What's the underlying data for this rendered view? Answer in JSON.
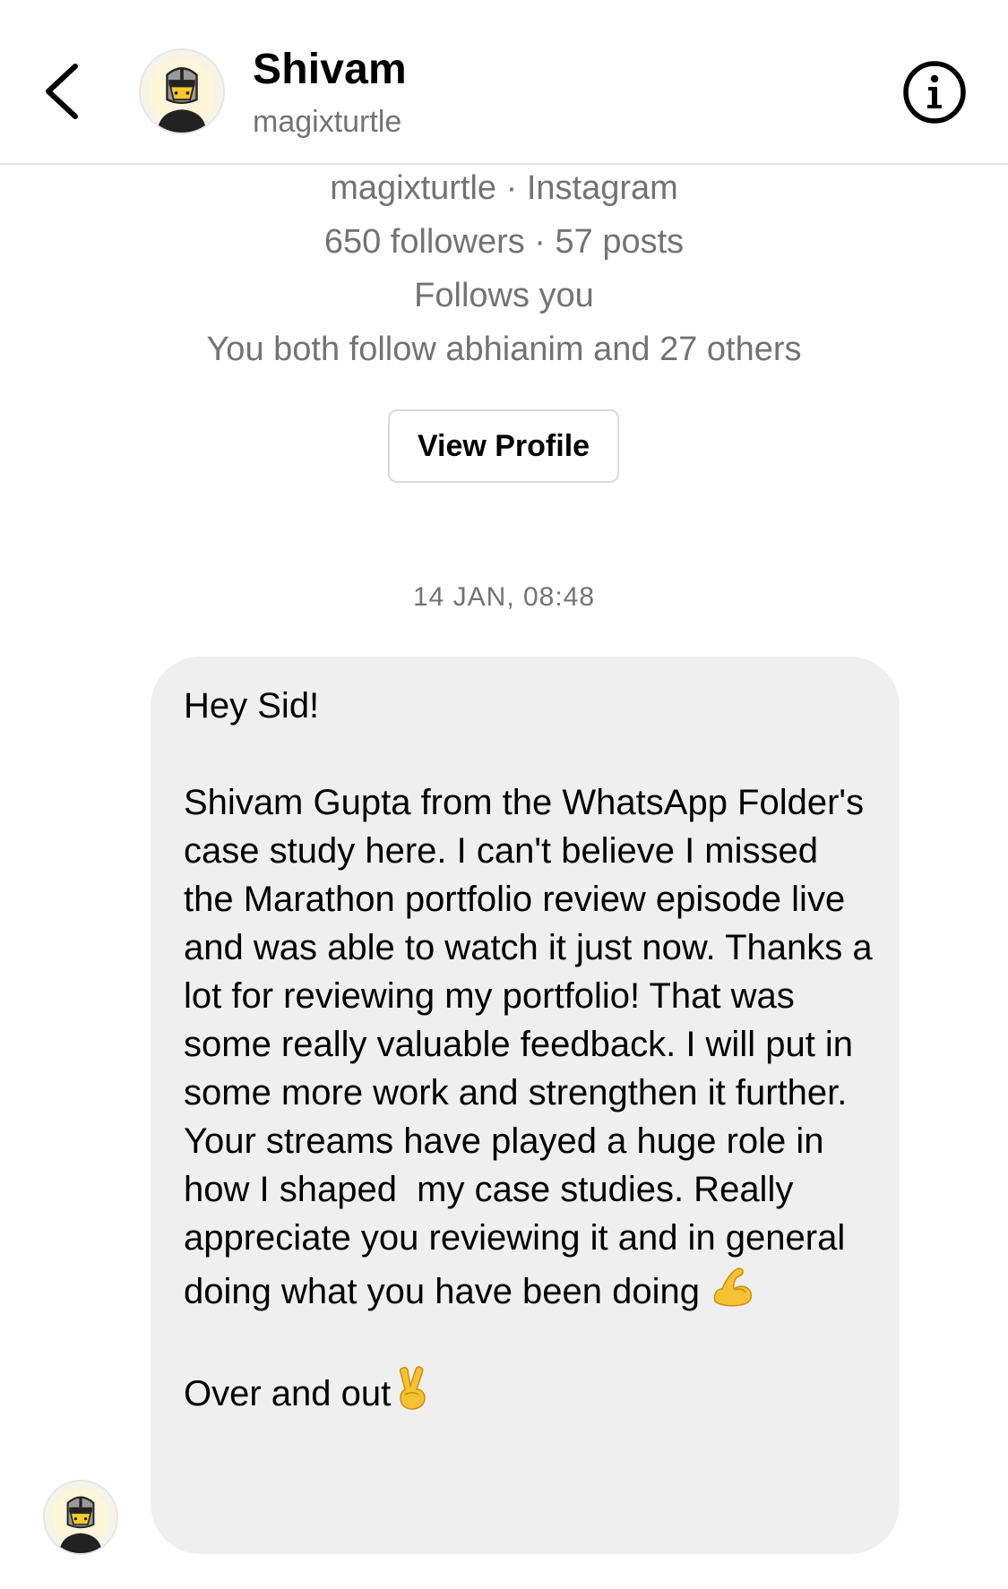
{
  "header": {
    "name": "Shivam",
    "username": "magixturtle",
    "back_icon": "chevron-left-icon",
    "info_icon": "info-circle-icon"
  },
  "profile": {
    "line1": "magixturtle · Instagram",
    "line2": "650 followers · 57 posts",
    "line3": "Follows you",
    "line4": "You both follow abhianim and 27 others",
    "view_profile_label": "View Profile"
  },
  "conversation": {
    "timestamp": "14 JAN, 08:48",
    "message": {
      "greeting": "Hey Sid!",
      "body": "Shivam Gupta from the WhatsApp Folder's case study here. I can't believe I missed the Marathon portfolio review episode live and was able to watch it just now. Thanks a lot for reviewing my portfolio! That was some really valuable feedback. I will put in some more work and strengthen it further. Your streams have played a huge role in how I shaped  my case studies. Really appreciate you reviewing it and in general doing what you have been doing",
      "body_emoji": "flexed-biceps-emoji",
      "signoff": "Over and out",
      "signoff_emoji": "victory-hand-emoji"
    }
  },
  "colors": {
    "bubble": "#efefef",
    "secondary_text": "#737373",
    "divider": "#e3e3e3",
    "emoji_skin": "#f6c234"
  }
}
